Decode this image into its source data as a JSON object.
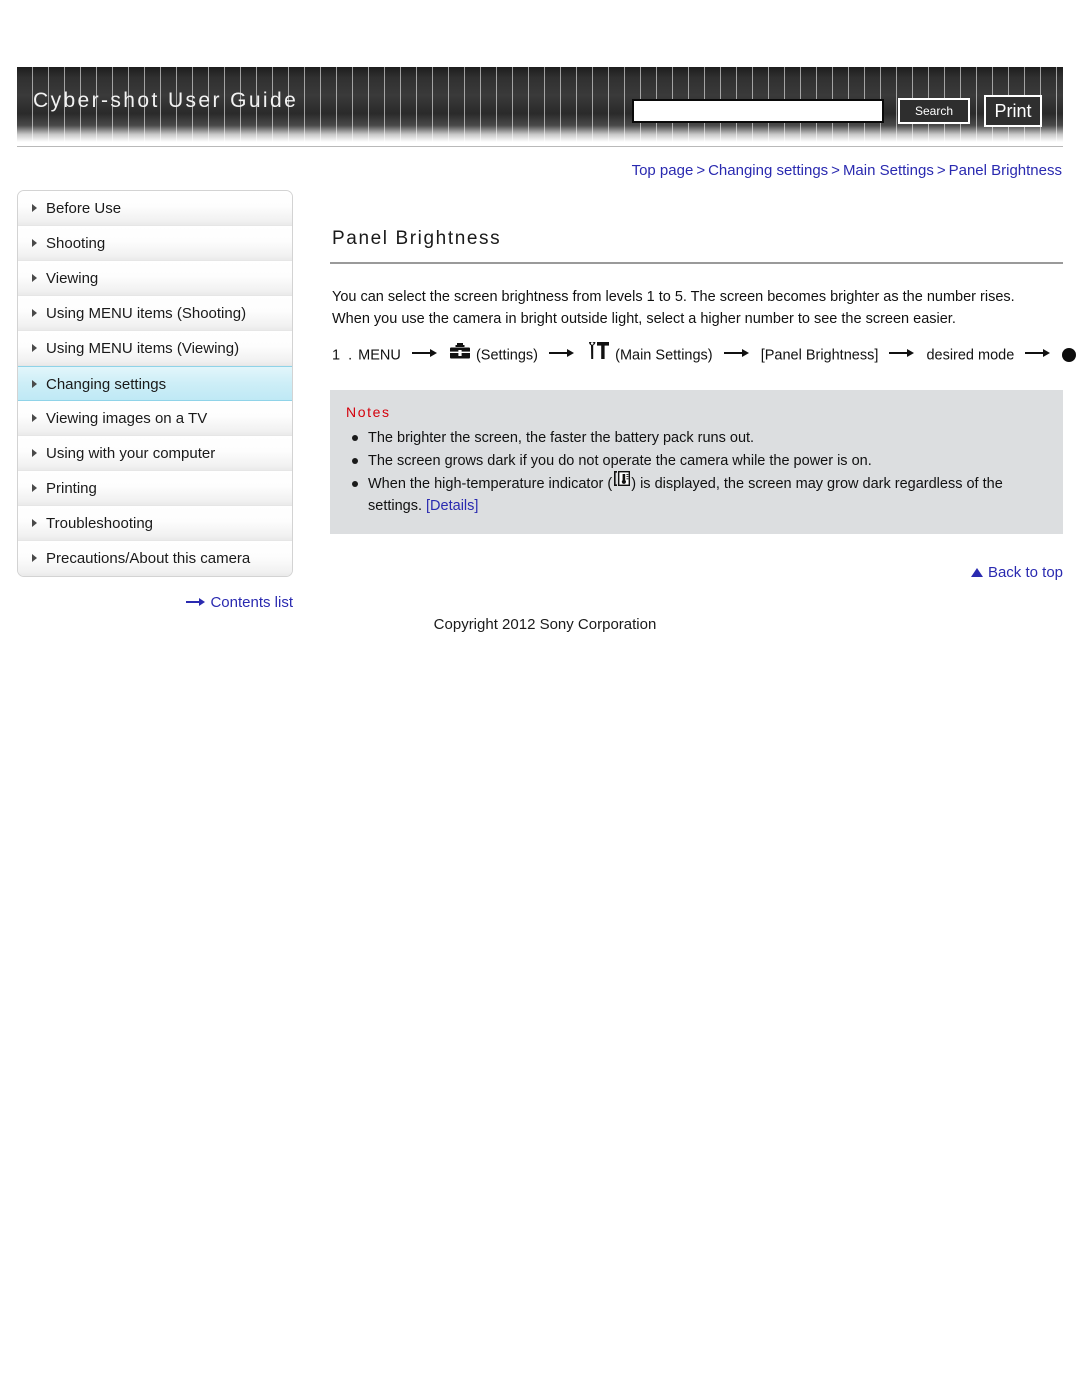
{
  "header": {
    "site_title": "Cyber-shot User Guide",
    "search_value": "",
    "search_placeholder": "",
    "search_button": "Search",
    "print_button": "Print"
  },
  "breadcrumb": {
    "items": [
      "Top page",
      "Changing settings",
      "Main Settings",
      "Panel Brightness"
    ],
    "separator": ">"
  },
  "sidebar": {
    "items": [
      {
        "label": "Before Use",
        "active": false
      },
      {
        "label": "Shooting",
        "active": false
      },
      {
        "label": "Viewing",
        "active": false
      },
      {
        "label": "Using MENU items (Shooting)",
        "active": false
      },
      {
        "label": "Using MENU items (Viewing)",
        "active": false
      },
      {
        "label": "Changing settings",
        "active": true
      },
      {
        "label": "Viewing images on a TV",
        "active": false
      },
      {
        "label": "Using with your computer",
        "active": false
      },
      {
        "label": "Printing",
        "active": false
      },
      {
        "label": "Troubleshooting",
        "active": false
      },
      {
        "label": "Precautions/About this camera",
        "active": false
      }
    ],
    "contents_link": "Contents list"
  },
  "main": {
    "title": "Panel Brightness",
    "paragraph_1": "You can select the screen brightness from levels 1 to 5. The screen becomes brighter as the number rises.",
    "paragraph_2": "When you use the camera in bright outside light, select a higher number to see the screen easier.",
    "step": {
      "number": "1 .",
      "menu_label": "MENU",
      "settings_label": "(Settings)",
      "main_settings_label": "(Main Settings)",
      "panel_brightness_label": "[Panel Brightness]",
      "desired_mode_label": "desired mode"
    },
    "notes": {
      "title": "Notes",
      "items": [
        "The brighter the screen, the faster the battery pack runs out.",
        "The screen grows dark if you do not operate the camera while the power is on."
      ],
      "item_3_before": "When the high-temperature indicator (",
      "item_3_after": ") is displayed, the screen may grow dark regardless of the settings.",
      "item_3_link": "[Details]"
    },
    "back_to_top": "Back to top"
  },
  "footer": {
    "copyright": "Copyright 2012 Sony Corporation"
  },
  "colors": {
    "link": "#2a2ab0",
    "notes_title": "#d4000b",
    "notes_bg": "#dcdee0",
    "active_nav": "#cdeef7"
  }
}
